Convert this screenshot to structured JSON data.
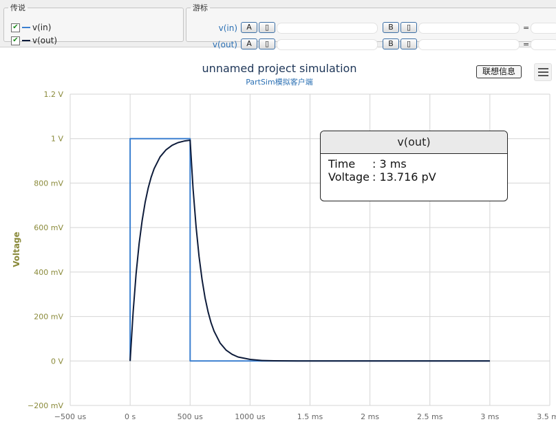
{
  "legend_panel": {
    "title": "传说",
    "items": [
      {
        "label": "v(in)",
        "checked": true,
        "color": "#3a7fd0"
      },
      {
        "label": "v(out)",
        "checked": true,
        "color": "#0d1b3a"
      }
    ]
  },
  "cursor_panel": {
    "title": "游标",
    "rows": [
      {
        "label": "v(in)",
        "btn_a": "A",
        "btn_b": "B",
        "glyph": "▯",
        "equals": "="
      },
      {
        "label": "v(out)",
        "btn_a": "A",
        "btn_b": "B",
        "glyph": "▯",
        "equals": "="
      }
    ]
  },
  "contact_button": "联想信息",
  "tooltip": {
    "title": "v(out)",
    "time_label": "Time",
    "time_value": ": 3 ms",
    "voltage_label": "Voltage",
    "voltage_value": ": 13.716 pV"
  },
  "chart_data": {
    "type": "line",
    "title": "unnamed project simulation",
    "subtitle": "PartSim模拟客户端",
    "xlabel": "",
    "ylabel": "Voltage",
    "xlim": [
      -500,
      3500
    ],
    "ylim": [
      -0.2,
      1.2
    ],
    "x_ticks": [
      {
        "value": -500,
        "label": "−500 us"
      },
      {
        "value": 0,
        "label": "0 s"
      },
      {
        "value": 500,
        "label": "500 us"
      },
      {
        "value": 1000,
        "label": "1000 us"
      },
      {
        "value": 1500,
        "label": "1.5 ms"
      },
      {
        "value": 2000,
        "label": "2 ms"
      },
      {
        "value": 2500,
        "label": "2.5 ms"
      },
      {
        "value": 3000,
        "label": "3 ms"
      },
      {
        "value": 3500,
        "label": "3.5 ms"
      }
    ],
    "y_ticks": [
      {
        "value": -0.2,
        "label": "−200 mV"
      },
      {
        "value": 0,
        "label": "0 V"
      },
      {
        "value": 0.2,
        "label": "200 mV"
      },
      {
        "value": 0.4,
        "label": "400 mV"
      },
      {
        "value": 0.6,
        "label": "600 mV"
      },
      {
        "value": 0.8,
        "label": "800 mV"
      },
      {
        "value": 1.0,
        "label": "1 V"
      },
      {
        "value": 1.2,
        "label": "1.2 V"
      }
    ],
    "grid": true,
    "series": [
      {
        "name": "v(in)",
        "color": "#3a7fd0",
        "x": [
          0,
          0,
          500,
          500,
          3000
        ],
        "y": [
          0,
          1,
          1,
          0,
          0
        ]
      },
      {
        "name": "v(out)",
        "color": "#0d1b3a",
        "x": [
          0,
          25,
          50,
          75,
          100,
          125,
          150,
          175,
          200,
          250,
          300,
          350,
          400,
          450,
          500,
          525,
          550,
          575,
          600,
          625,
          650,
          675,
          700,
          750,
          800,
          850,
          900,
          1000,
          1100,
          1200,
          1400,
          1700,
          2000,
          2500,
          3000
        ],
        "y": [
          0,
          0.221,
          0.393,
          0.528,
          0.632,
          0.713,
          0.777,
          0.826,
          0.865,
          0.918,
          0.95,
          0.97,
          0.982,
          0.989,
          0.993,
          0.773,
          0.602,
          0.469,
          0.365,
          0.284,
          0.221,
          0.172,
          0.134,
          0.081,
          0.049,
          0.03,
          0.018,
          0.007,
          0.002,
          0.001,
          0,
          0,
          0,
          0,
          0
        ]
      }
    ]
  }
}
